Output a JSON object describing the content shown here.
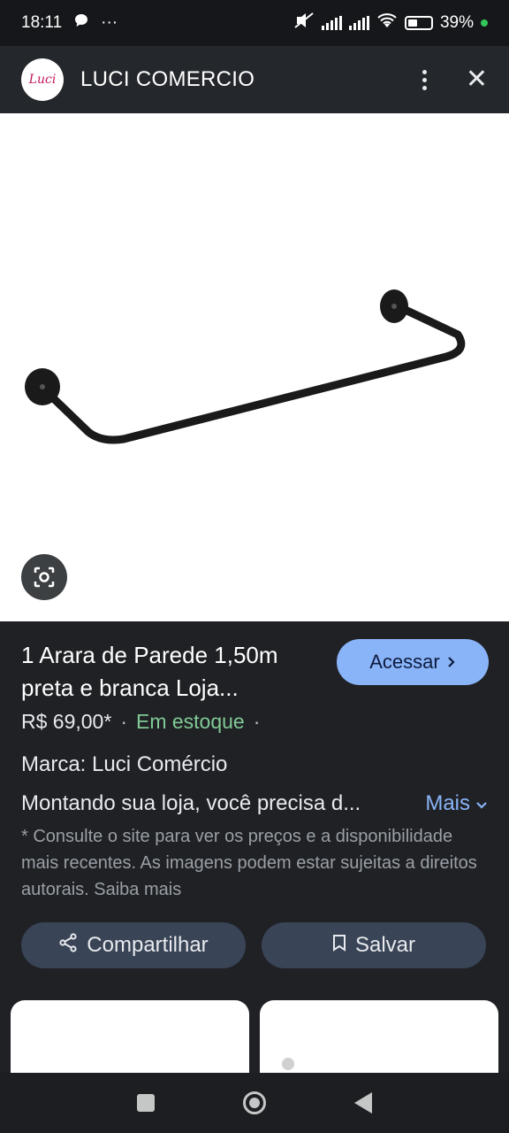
{
  "status_bar": {
    "time": "18:11",
    "chat_icon": "chat-bubble-icon",
    "overflow": "···",
    "battery_level": "39%",
    "battery_percent": 39,
    "charging_color": "#34c759"
  },
  "header": {
    "logo_text": "Luci",
    "site_name": "LUCI COMERCIO",
    "menu_icon": "more-vert-icon",
    "close_icon": "close-icon"
  },
  "product": {
    "image_icon": "lens-search-icon",
    "title": "1 Arara de Parede 1,50m preta e branca Loja...",
    "access_label": "Acessar",
    "price": "R$ 69,00*",
    "stock": "Em estoque",
    "brand": "Marca: Luci Comércio",
    "description": "Montando sua loja, você precisa d...",
    "more_label": "Mais",
    "disclaimer": "* Consulte o site para ver os preços e a disponibilidade mais recentes. As imagens podem estar sujeitas a direitos autorais. Saiba mais"
  },
  "actions": {
    "share_label": "Compartilhar",
    "save_label": "Salvar"
  },
  "colors": {
    "accent": "#8ab4f8",
    "stock_green": "#81c995",
    "background": "#1f2125",
    "button_bg": "#394457"
  }
}
